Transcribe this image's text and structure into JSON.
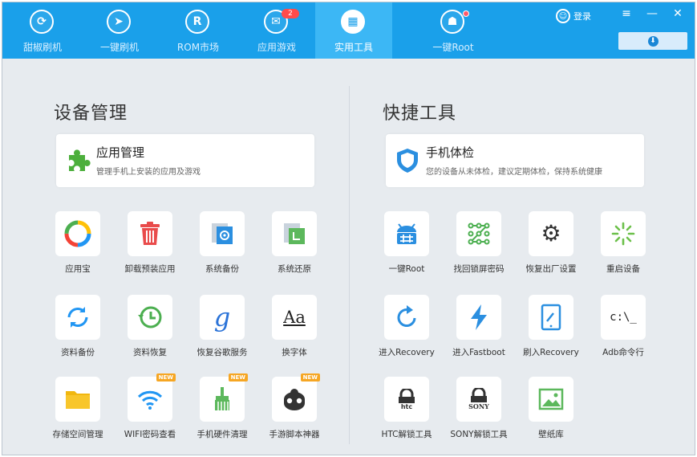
{
  "nav": {
    "items": [
      {
        "label": "甜椒刷机",
        "icon": "pepper-icon"
      },
      {
        "label": "一键刷机",
        "icon": "cursor-icon"
      },
      {
        "label": "ROM市场",
        "icon": "rom-icon"
      },
      {
        "label": "应用游戏",
        "icon": "mail-icon",
        "badge": "2"
      },
      {
        "label": "实用工具",
        "icon": "grid-icon"
      },
      {
        "label": "一键Root",
        "icon": "android-icon"
      }
    ],
    "login": "登录"
  },
  "colors": {
    "topbar": "#1aa0ea",
    "active_tab": "#3cb7f5",
    "background": "#e7ebef",
    "badge": "#ff4b4b",
    "new_badge": "#f6a623"
  },
  "left": {
    "title": "设备管理",
    "card": {
      "title": "应用管理",
      "subtitle": "管理手机上安装的应用及游戏",
      "icon": "puzzle-icon"
    },
    "tools": [
      {
        "label": "应用宝",
        "icon": "yingyongbao-icon"
      },
      {
        "label": "卸载预装应用",
        "icon": "trash-icon"
      },
      {
        "label": "系统备份",
        "icon": "system-backup-icon"
      },
      {
        "label": "系统还原",
        "icon": "system-restore-icon"
      },
      {
        "label": "资料备份",
        "icon": "sync-icon"
      },
      {
        "label": "资料恢复",
        "icon": "history-icon"
      },
      {
        "label": "恢复谷歌服务",
        "icon": "google-icon"
      },
      {
        "label": "换字体",
        "icon": "font-icon",
        "glyph": "Aa"
      },
      {
        "label": "存储空间管理",
        "icon": "folder-icon"
      },
      {
        "label": "WIFI密码查看",
        "icon": "wifi-icon",
        "new": "NEW"
      },
      {
        "label": "手机硬件清理",
        "icon": "broom-icon",
        "new": "NEW"
      },
      {
        "label": "手游脚本神器",
        "icon": "game-script-icon",
        "new": "NEW"
      }
    ]
  },
  "right": {
    "title": "快捷工具",
    "card": {
      "title": "手机体检",
      "subtitle": "您的设备从未体检，建议定期体检，保持系统健康",
      "icon": "shield-icon"
    },
    "tools": [
      {
        "label": "一键Root",
        "icon": "root-icon"
      },
      {
        "label": "找回锁屏密码",
        "icon": "pattern-lock-icon"
      },
      {
        "label": "恢复出厂设置",
        "icon": "gears-icon"
      },
      {
        "label": "重启设备",
        "icon": "loading-icon"
      },
      {
        "label": "进入Recovery",
        "icon": "refresh-icon"
      },
      {
        "label": "进入Fastboot",
        "icon": "lightning-icon"
      },
      {
        "label": "刷入Recovery",
        "icon": "tablet-icon"
      },
      {
        "label": "Adb命令行",
        "icon": "terminal-icon",
        "glyph": "c:\\_"
      },
      {
        "label": "HTC解锁工具",
        "icon": "htc-lock-icon",
        "glyph": "htc"
      },
      {
        "label": "SONY解锁工具",
        "icon": "sony-lock-icon",
        "glyph": "SONY"
      },
      {
        "label": "壁纸库",
        "icon": "image-icon"
      }
    ]
  }
}
